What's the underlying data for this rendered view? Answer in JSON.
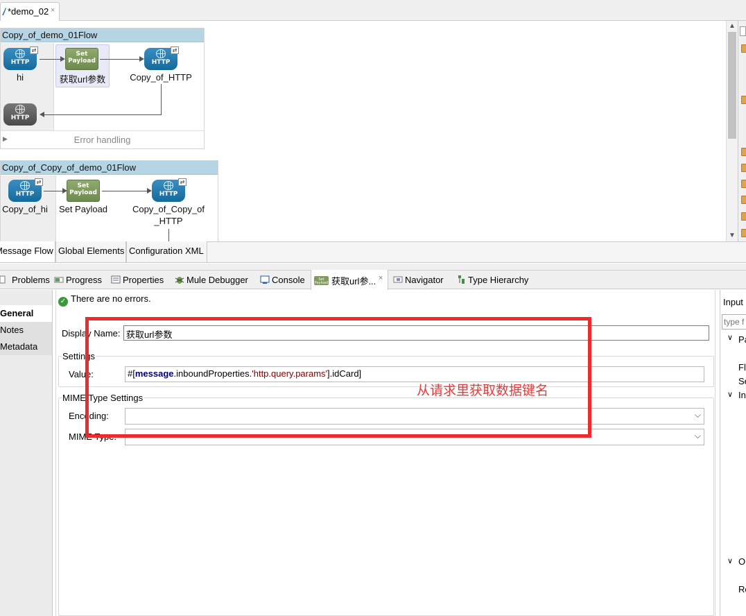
{
  "editor": {
    "tab_title": "*demo_02",
    "tab_close": "×"
  },
  "canvas": {
    "flow1": {
      "title": "Copy_of_demo_01Flow",
      "source_label": "hi",
      "processor_label": "获取url参数",
      "outbound_label": "Copy_of_HTTP",
      "error_handling": "Error handling",
      "expand_glyph": "▶"
    },
    "flow2": {
      "title": "Copy_of_Copy_of_demo_01Flow",
      "source_label": "Copy_of_hi",
      "processor_label": "Set Payload",
      "outbound_label_1": "Copy_of_Copy_of",
      "outbound_label_2": "_HTTP"
    },
    "http_text": "HTTP",
    "payload_line1": "Set",
    "payload_line2": "Payload",
    "badge_glyph": "⇄"
  },
  "editor_bottom_tabs": [
    "Message Flow",
    "Global Elements",
    "Configuration XML"
  ],
  "view_tabs": {
    "problems": "Problems",
    "progress": "Progress",
    "properties": "Properties",
    "mule_debugger": "Mule Debugger",
    "console": "Console",
    "active_tab": "获取url参...",
    "navigator": "Navigator",
    "type_hierarchy": "Type Hierarchy",
    "close": "×"
  },
  "properties": {
    "status": "There are no errors.",
    "nav": [
      "General",
      "Notes",
      "Metadata"
    ],
    "display_name_label": "Display Name:",
    "display_name_value": "获取url参数",
    "settings_title": "Settings",
    "value_label": "Value:",
    "value_prefix": "#[",
    "value_keyword": "message",
    "value_mid": ".inboundProperties.",
    "value_string": "'http.query.params'",
    "value_suffix": "].idCard]",
    "mime_title": "MIME Type Settings",
    "encoding_label": "Encoding:",
    "encoding_value": "",
    "mime_type_label": "MIME Type:",
    "mime_type_value": ""
  },
  "annotation": {
    "text": "从请求里获取数据键名",
    "color": "#ec2c2c"
  },
  "right_panel": {
    "title": "Input",
    "search_placeholder": "type f",
    "item_pa": "Pa",
    "item_fl": "Fl",
    "item_se": "Se",
    "item_in": "In",
    "item_o": "O",
    "item_re": "Re"
  }
}
